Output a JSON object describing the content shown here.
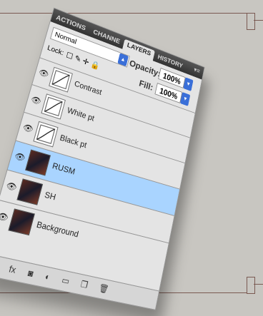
{
  "tabs": [
    {
      "label": "ACTIONS",
      "active": false
    },
    {
      "label": "CHANNE",
      "active": false
    },
    {
      "label": "LAYERS",
      "active": true
    },
    {
      "label": "HISTORY",
      "active": false
    }
  ],
  "blend_mode": "Normal",
  "lock_label": "Lock:",
  "opacity_label": "Opacity:",
  "opacity_value": "100%",
  "fill_label": "Fill:",
  "fill_value": "100%",
  "layers": [
    {
      "name": "Contrast",
      "kind": "adjustment",
      "selected": false
    },
    {
      "name": "White pt",
      "kind": "adjustment",
      "selected": false
    },
    {
      "name": "Black pt",
      "kind": "adjustment",
      "selected": false
    },
    {
      "name": "RUSM",
      "kind": "photo",
      "selected": true
    },
    {
      "name": "SH",
      "kind": "photo",
      "selected": false
    },
    {
      "name": "Background",
      "kind": "photo",
      "selected": false
    }
  ],
  "colors": {
    "selected_row": "#a9d4ff",
    "dropdown_accent": "#3a6fd8"
  }
}
